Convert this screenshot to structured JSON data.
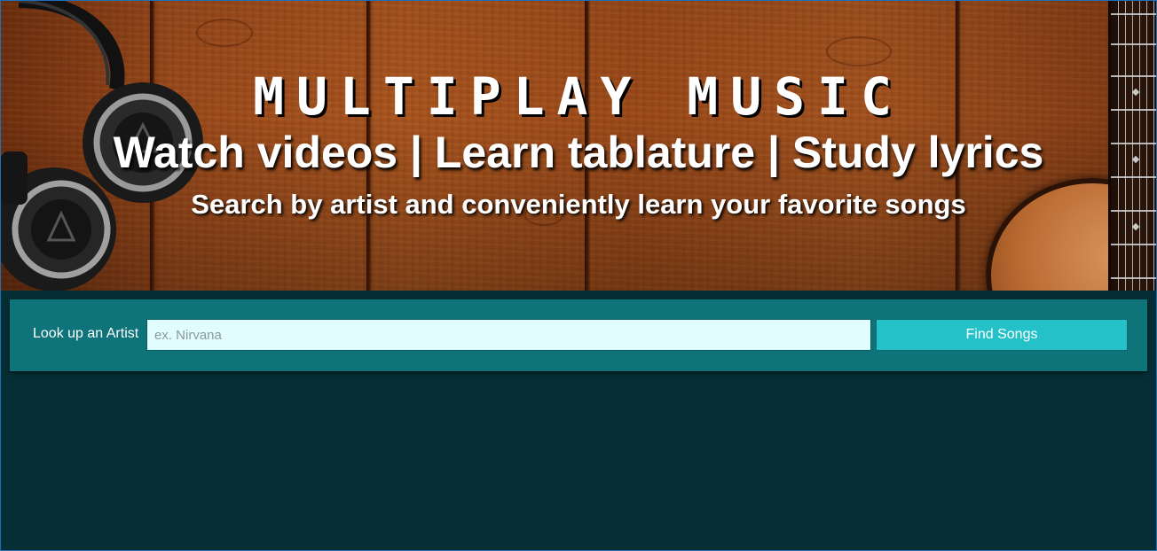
{
  "hero": {
    "title": "MULTIPLAY MUSIC",
    "tagline": "Watch videos | Learn tablature | Study lyrics",
    "subtagline": "Search by artist and conveniently learn your favorite songs"
  },
  "search": {
    "label": "Look up an Artist",
    "placeholder": "ex. Nirvana",
    "value": "",
    "button_label": "Find Songs"
  },
  "colors": {
    "panel": "#0e747a",
    "button": "#24c1c8",
    "input_bg": "#e2fdfd",
    "page_bg": "#052f35"
  },
  "icons": {
    "left_decoration": "headphones-image",
    "right_decoration": "guitar-image"
  }
}
